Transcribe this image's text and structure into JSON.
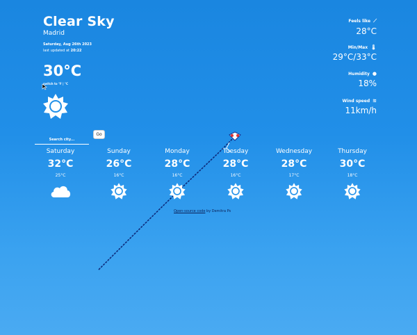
{
  "current": {
    "description": "Clear Sky",
    "city": "Madrid",
    "date": "Saturday, Aug 26th 2023",
    "updated_prefix": "last updated at",
    "updated_time": "20:22",
    "temperature": "30°C",
    "unit_switch": "switch to °F | °C",
    "icon": "sun-icon"
  },
  "search": {
    "placeholder": "Search city...",
    "button_label": "Go"
  },
  "details": {
    "feels_like": {
      "label": "Feels like",
      "value": "28°C",
      "icon": "thermometer-icon"
    },
    "min_max": {
      "label": "Min/Max",
      "value": "29°C/33°C",
      "icon": "thermometer-range-icon"
    },
    "humidity": {
      "label": "Humidity",
      "value": "18%",
      "icon": "droplet-icon"
    },
    "wind": {
      "label": "Wind speed",
      "value": "11km/h",
      "icon": "wind-icon"
    }
  },
  "forecast": [
    {
      "day": "Saturday",
      "max": "32°C",
      "min": "25°C",
      "icon": "cloud-icon"
    },
    {
      "day": "Sunday",
      "max": "26°C",
      "min": "16°C",
      "icon": "sun-icon"
    },
    {
      "day": "Monday",
      "max": "28°C",
      "min": "16°C",
      "icon": "sun-icon"
    },
    {
      "day": "Tuesday",
      "max": "28°C",
      "min": "16°C",
      "icon": "sun-icon"
    },
    {
      "day": "Wednesday",
      "max": "28°C",
      "min": "17°C",
      "icon": "sun-icon"
    },
    {
      "day": "Thursday",
      "max": "30°C",
      "min": "18°C",
      "icon": "sun-icon"
    }
  ],
  "footer": {
    "link_text": "Open-source code",
    "suffix": "by Demitra Ps"
  },
  "colors": {
    "sky_top": "#1a86e0",
    "sky_bottom": "#4aaaf2",
    "footer_text": "#0b1e55"
  }
}
